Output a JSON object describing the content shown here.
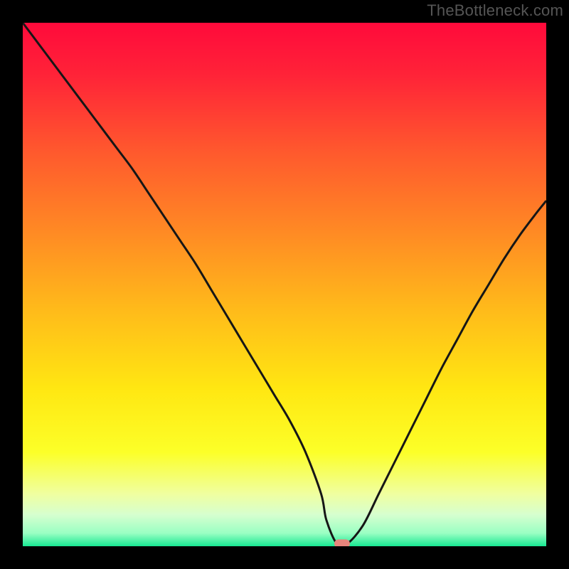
{
  "watermark": "TheBottleneck.com",
  "colors": {
    "background": "#000000",
    "curve_stroke": "#161616",
    "marker_fill": "#e7857c",
    "gradient_stops": [
      {
        "offset": 0.0,
        "color": "#ff0a3b"
      },
      {
        "offset": 0.1,
        "color": "#ff2338"
      },
      {
        "offset": 0.25,
        "color": "#ff5a2d"
      },
      {
        "offset": 0.4,
        "color": "#ff8a24"
      },
      {
        "offset": 0.55,
        "color": "#ffbb1a"
      },
      {
        "offset": 0.7,
        "color": "#ffe712"
      },
      {
        "offset": 0.82,
        "color": "#fcff28"
      },
      {
        "offset": 0.9,
        "color": "#f0ffa0"
      },
      {
        "offset": 0.94,
        "color": "#d6ffcf"
      },
      {
        "offset": 0.975,
        "color": "#9affc3"
      },
      {
        "offset": 1.0,
        "color": "#17e892"
      }
    ]
  },
  "chart_data": {
    "type": "line",
    "title": "",
    "xlabel": "",
    "ylabel": "",
    "xlim": [
      0,
      100
    ],
    "ylim": [
      0,
      100
    ],
    "grid": false,
    "legend": false,
    "x": [
      0,
      3,
      6,
      9,
      12,
      15,
      18,
      21,
      24,
      27,
      30,
      33,
      36,
      39,
      42,
      45,
      48,
      51,
      54,
      57,
      58,
      60,
      62,
      65,
      68,
      71,
      74,
      77,
      80,
      83,
      86,
      89,
      92,
      95,
      98,
      100
    ],
    "values": [
      100,
      96,
      92,
      88,
      84,
      80,
      76,
      72,
      67.5,
      63,
      58.5,
      54,
      49,
      44,
      39,
      34,
      29,
      24,
      18,
      10,
      5,
      0.5,
      0.5,
      4,
      10,
      16,
      22,
      28,
      34,
      39.5,
      45,
      50,
      55,
      59.5,
      63.5,
      66
    ],
    "marker": {
      "x": 61,
      "y": 0.5
    }
  }
}
